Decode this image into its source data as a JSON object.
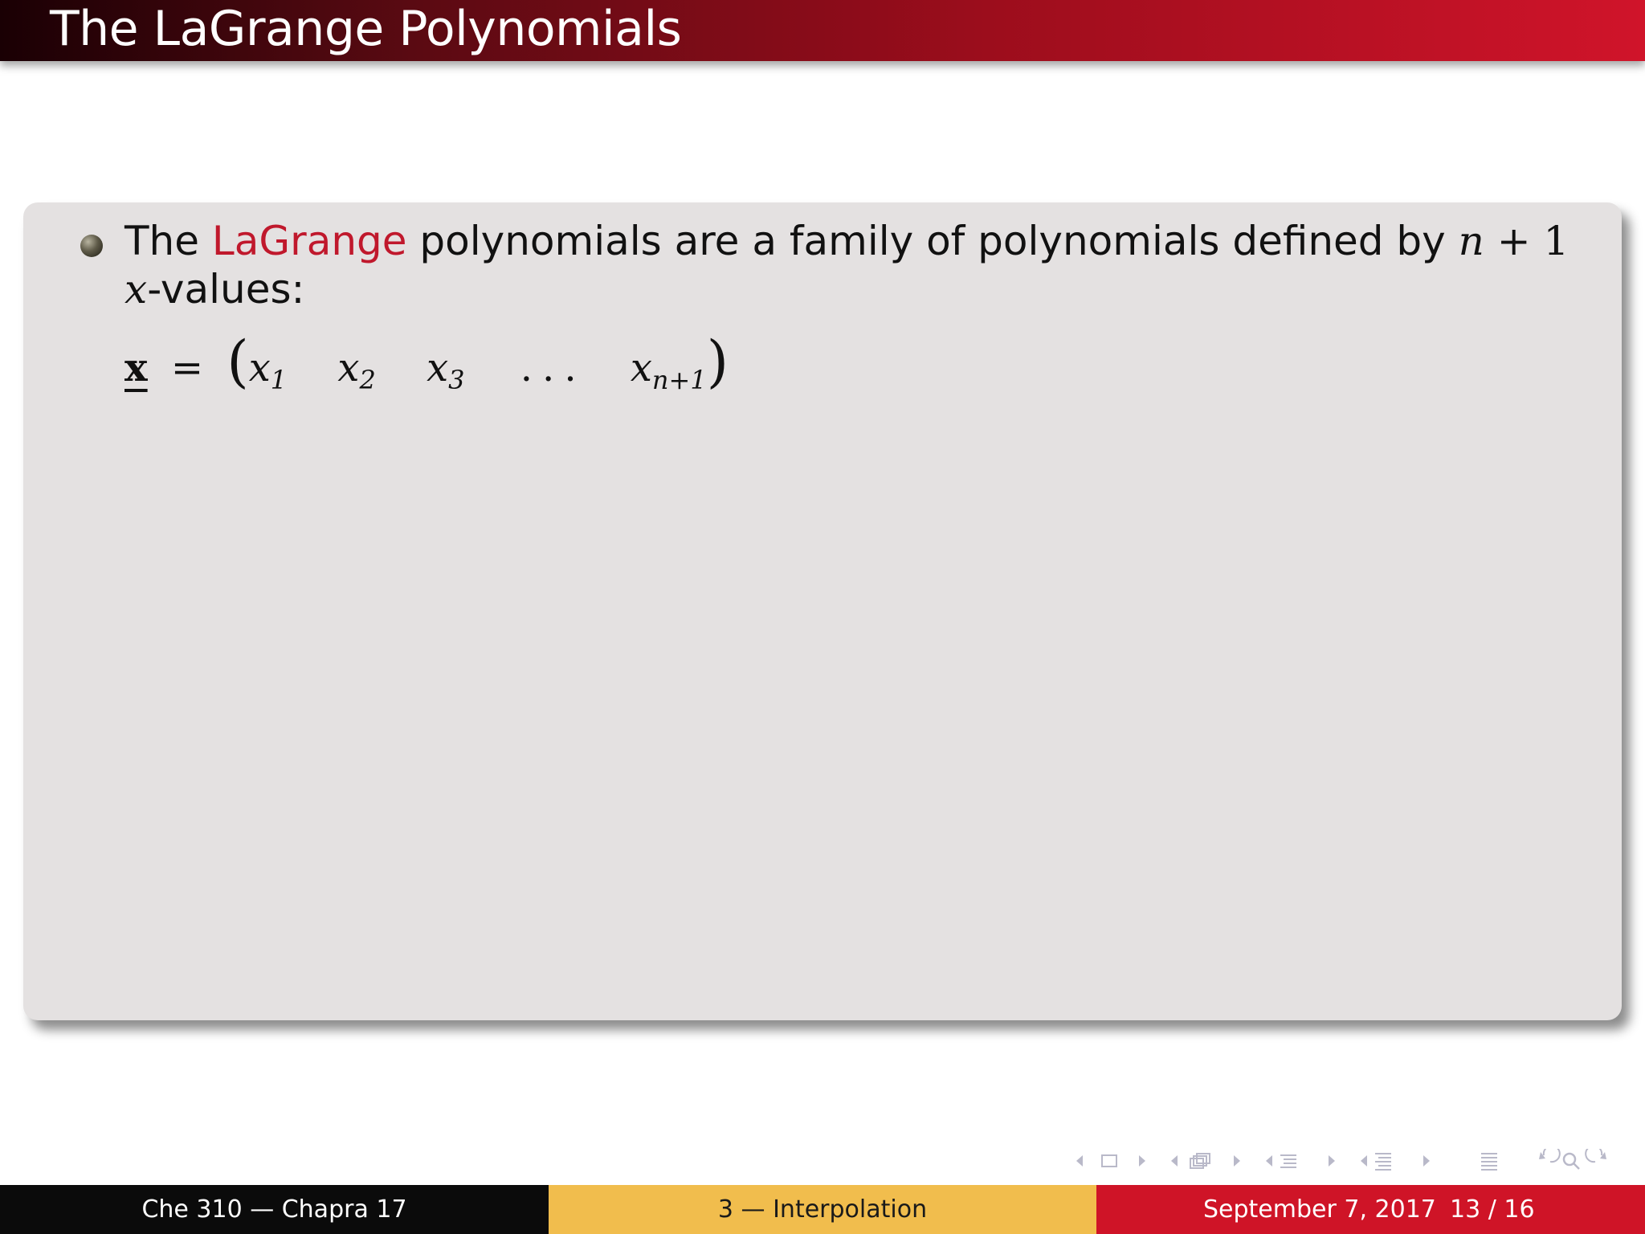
{
  "slide": {
    "title": "The LaGrange Polynomials"
  },
  "bullet": {
    "text_1": "The ",
    "highlight": "LaGrange",
    "text_2": " polynomials are a family of polynomials defined by ",
    "math_n": "n",
    "math_plus_1": " + 1",
    "math_x": "x",
    "text_3": "-values:"
  },
  "equation": {
    "vector": "x",
    "equals": "=",
    "open_paren": "(",
    "close_paren": ")",
    "terms": [
      {
        "base": "x",
        "sub": "1"
      },
      {
        "base": "x",
        "sub": "2"
      },
      {
        "base": "x",
        "sub": "3"
      },
      {
        "base": "...",
        "sub": ""
      },
      {
        "base": "x",
        "sub": "n+1"
      }
    ]
  },
  "navigation": {
    "icons": [
      "nav-left-arrow-icon",
      "frame-icon",
      "nav-right-arrow-icon",
      "nav-left-arrow-icon",
      "subsection-icon",
      "nav-right-arrow-icon",
      "nav-left-arrow-icon",
      "section-icon",
      "nav-right-arrow-icon",
      "nav-left-arrow-icon",
      "document-icon",
      "nav-right-arrow-icon",
      "outline-icon",
      "back-icon",
      "search-icon",
      "forward-icon"
    ]
  },
  "footer": {
    "course": "Che 310 — Chapra 17",
    "section": "3 — Interpolation",
    "date": "September 7, 2017",
    "page": "13 / 16"
  },
  "colors": {
    "accent": "#c0182c",
    "footer_left": "#0b0b0b",
    "footer_middle": "#f1bd4d",
    "footer_right": "#cf1427",
    "block_background": "#e4e1e1"
  }
}
